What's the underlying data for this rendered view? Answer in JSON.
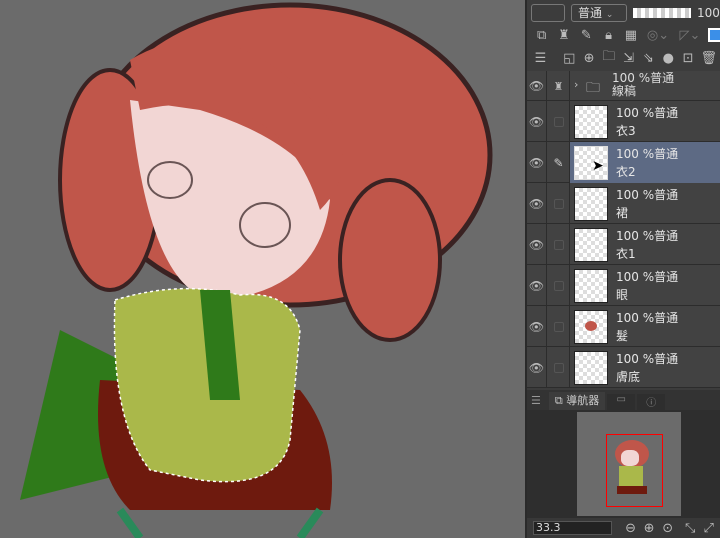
{
  "toolbar": {
    "blend_mode": "普通",
    "opacity": "100"
  },
  "layers": [
    {
      "name": "線稿",
      "opacity_mode": "100 %普通",
      "type": "folder",
      "selected": false
    },
    {
      "name": "衣3",
      "opacity_mode": "100 %普通",
      "selected": false
    },
    {
      "name": "衣2",
      "opacity_mode": "100 %普通",
      "selected": true
    },
    {
      "name": "裙",
      "opacity_mode": "100 %普通",
      "selected": false
    },
    {
      "name": "衣1",
      "opacity_mode": "100 %普通",
      "selected": false
    },
    {
      "name": "眼",
      "opacity_mode": "100 %普通",
      "selected": false
    },
    {
      "name": "髮",
      "opacity_mode": "100 %普通",
      "selected": false
    },
    {
      "name": "膚底",
      "opacity_mode": "100 %普通",
      "selected": false
    }
  ],
  "navigator": {
    "tab_label": "導航器",
    "zoom": "33.3"
  },
  "colors": {
    "selected_layer": "#5d6a84",
    "hair": "#c0564a",
    "skin": "#f2d6d4",
    "shirt": "#aab84a",
    "skirt": "#6e1a0e",
    "ribbon": "#2f7a1a",
    "nav_frame": "#ff0000"
  }
}
